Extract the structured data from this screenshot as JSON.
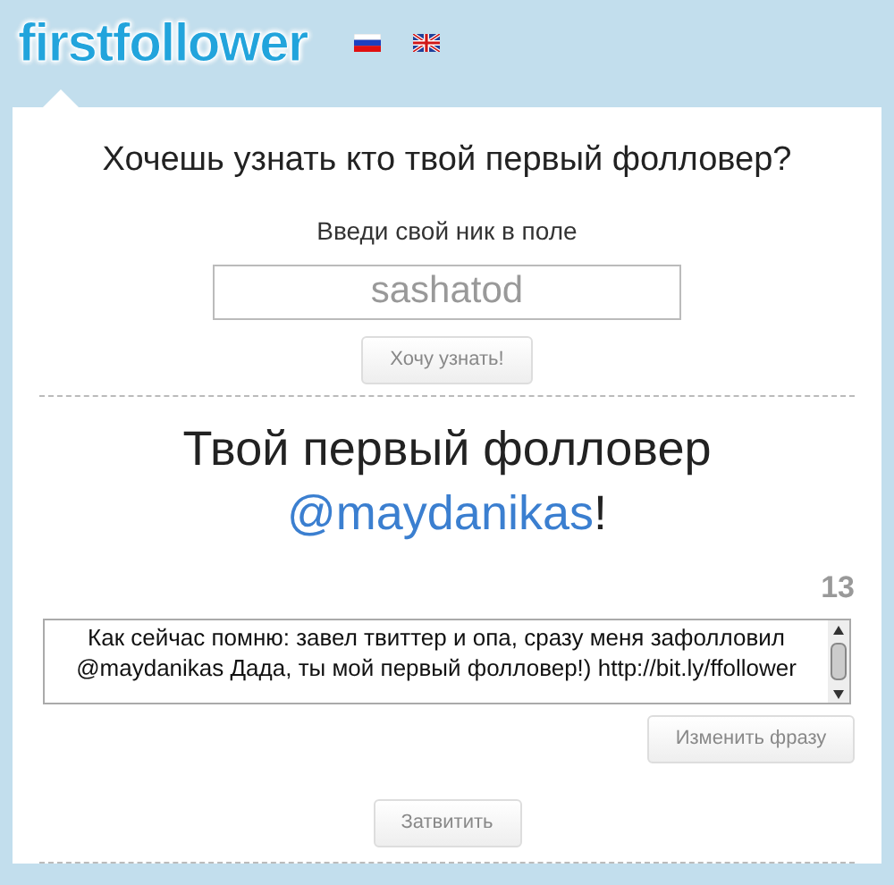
{
  "header": {
    "logo": "firstfollower",
    "languages": [
      {
        "kind": "ru",
        "selected": false
      },
      {
        "kind": "en",
        "selected": false
      }
    ]
  },
  "form": {
    "question": "Хочешь узнать кто твой первый фолловер?",
    "label": "Введи свой ник в поле",
    "value": "sashatod",
    "button": "Хочу узнать!"
  },
  "result": {
    "title": "Твой первый фолловер",
    "handle": "@maydanikas",
    "suffix": "!",
    "counter": "13",
    "message": "Как сейчас помню: завел твиттер и опа, сразу меня зафолловил @maydanikas Дада, ты мой первый фолловер!) http://bit.ly/ffollower",
    "change_button": "Изменить фразу",
    "tweet_button": "Затвитить"
  }
}
